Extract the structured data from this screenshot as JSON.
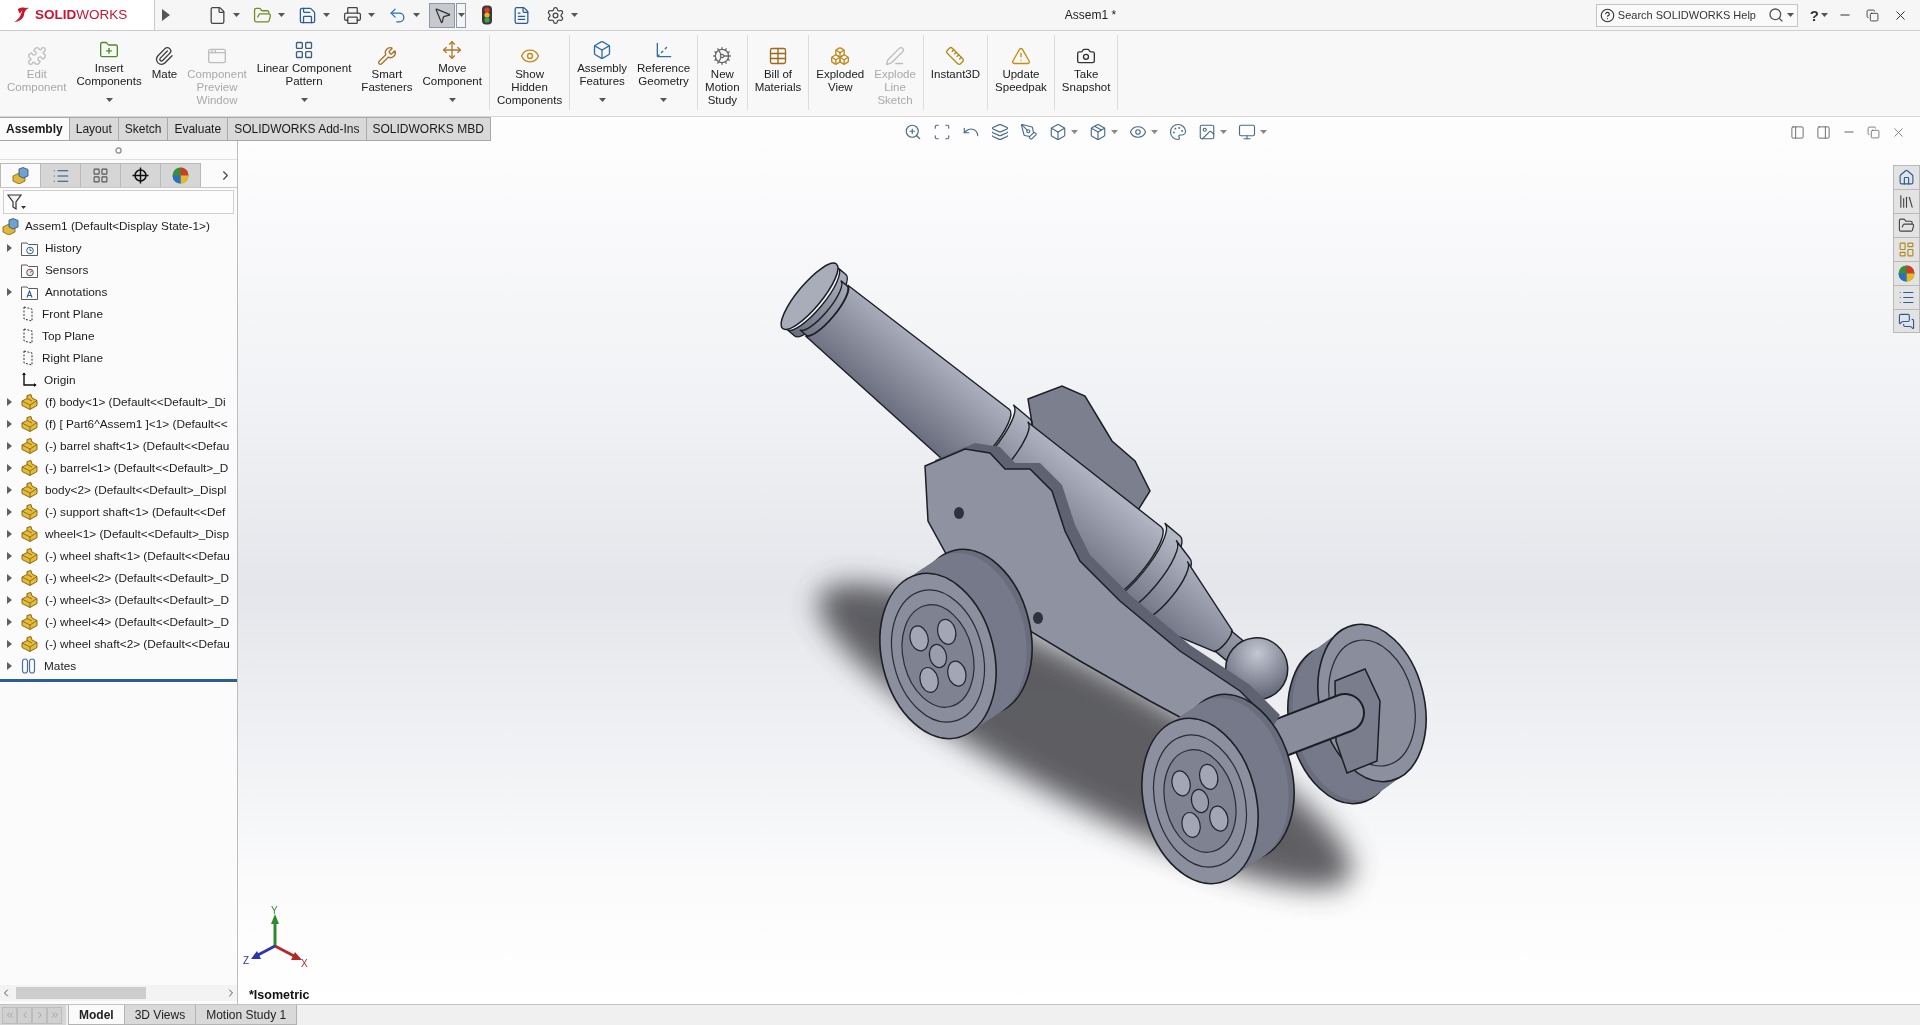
{
  "window": {
    "title": "Assem1 *"
  },
  "logo": {
    "text": "**SOLID**WORKS"
  },
  "quick_access": [
    {
      "selected": false,
      "dropdown": true
    },
    {
      "selected": false,
      "dropdown": true
    },
    {
      "selected": false,
      "dropdown": true
    },
    {
      "selected": false,
      "dropdown": true
    },
    {
      "selected": false,
      "dropdown": true
    },
    {
      "selected": true,
      "dropdown": true
    },
    {
      "selected": false,
      "dropdown": false
    },
    {
      "selected": false,
      "dropdown": false
    },
    {
      "selected": false,
      "dropdown": true
    }
  ],
  "help_search": {
    "placeholder": "Search SOLIDWORKS Help"
  },
  "help_menu": {
    "label": "?"
  },
  "command_manager": {
    "groups": [
      {
        "buttons": [
          {
            "lines": [
              "Edit",
              "Component"
            ],
            "disabled": true,
            "dropdown": false
          },
          {
            "lines": [
              "Insert",
              "Components"
            ],
            "disabled": false,
            "dropdown": true
          },
          {
            "lines": [
              "Mate"
            ],
            "disabled": false,
            "dropdown": false
          },
          {
            "lines": [
              "Component",
              "Preview",
              "Window"
            ],
            "disabled": true,
            "dropdown": false
          },
          {
            "lines": [
              "Linear Component",
              "Pattern"
            ],
            "disabled": false,
            "dropdown": true
          },
          {
            "lines": [
              "Smart",
              "Fasteners"
            ],
            "disabled": false,
            "dropdown": false
          },
          {
            "lines": [
              "Move",
              "Component"
            ],
            "disabled": false,
            "dropdown": true
          }
        ]
      },
      {
        "buttons": [
          {
            "lines": [
              "Show",
              "Hidden",
              "Components"
            ],
            "disabled": false,
            "dropdown": false
          }
        ]
      },
      {
        "buttons": [
          {
            "lines": [
              "Assembly",
              "Features"
            ],
            "disabled": false,
            "dropdown": true
          },
          {
            "lines": [
              "Reference",
              "Geometry"
            ],
            "disabled": false,
            "dropdown": true
          }
        ]
      },
      {
        "buttons": [
          {
            "lines": [
              "New",
              "Motion",
              "Study"
            ],
            "disabled": false,
            "dropdown": false
          }
        ]
      },
      {
        "buttons": [
          {
            "lines": [
              "Bill of",
              "Materials"
            ],
            "disabled": false,
            "dropdown": false
          }
        ]
      },
      {
        "buttons": [
          {
            "lines": [
              "Exploded",
              "View"
            ],
            "disabled": false,
            "dropdown": false
          },
          {
            "lines": [
              "Explode",
              "Line",
              "Sketch"
            ],
            "disabled": true,
            "dropdown": false
          }
        ]
      },
      {
        "buttons": [
          {
            "lines": [
              "Instant3D"
            ],
            "disabled": false,
            "dropdown": false
          }
        ]
      },
      {
        "buttons": [
          {
            "lines": [
              "Update",
              "Speedpak"
            ],
            "disabled": false,
            "dropdown": false
          }
        ]
      },
      {
        "buttons": [
          {
            "lines": [
              "Take",
              "Snapshot"
            ],
            "disabled": false,
            "dropdown": false
          }
        ]
      }
    ]
  },
  "command_tabs": [
    {
      "label": "Assembly",
      "selected": true
    },
    {
      "label": "Layout",
      "selected": false
    },
    {
      "label": "Sketch",
      "selected": false
    },
    {
      "label": "Evaluate",
      "selected": false
    },
    {
      "label": "SOLIDWORKS Add-Ins",
      "selected": false
    },
    {
      "label": "SOLIDWORKS MBD",
      "selected": false
    }
  ],
  "panel_tabs": [
    {
      "selected": true
    },
    {
      "selected": false
    },
    {
      "selected": false
    },
    {
      "selected": false
    },
    {
      "selected": false
    }
  ],
  "feature_tree": {
    "root": {
      "label": "Assem1 (Default<Display State-1>)",
      "kind": "assembly",
      "children": [
        {
          "label": "History",
          "kind": "history",
          "expander": true
        },
        {
          "label": "Sensors",
          "kind": "sensors",
          "expander": false
        },
        {
          "label": "Annotations",
          "kind": "annotations",
          "expander": true
        },
        {
          "label": "Front Plane",
          "kind": "plane",
          "expander": false
        },
        {
          "label": "Top Plane",
          "kind": "plane",
          "expander": false
        },
        {
          "label": "Right Plane",
          "kind": "plane",
          "expander": false
        },
        {
          "label": "Origin",
          "kind": "origin",
          "expander": false
        },
        {
          "label": "(f) body<1> (Default<<Default>_Di",
          "kind": "part",
          "expander": true
        },
        {
          "label": "(f) [ Part6^Assem1 ]<1> (Default<<",
          "kind": "part",
          "expander": true
        },
        {
          "label": "(-) barrel shaft<1> (Default<<Defau",
          "kind": "part",
          "expander": true
        },
        {
          "label": "(-) barrel<1> (Default<<Default>_D",
          "kind": "part",
          "expander": true
        },
        {
          "label": "body<2> (Default<<Default>_Displ",
          "kind": "part",
          "expander": true
        },
        {
          "label": "(-) support shaft<1> (Default<<Def",
          "kind": "part",
          "expander": true
        },
        {
          "label": "wheel<1> (Default<<Default>_Disp",
          "kind": "part",
          "expander": true
        },
        {
          "label": "(-) wheel shaft<1> (Default<<Defau",
          "kind": "part",
          "expander": true
        },
        {
          "label": "(-) wheel<2> (Default<<Default>_D",
          "kind": "part",
          "expander": true
        },
        {
          "label": "(-) wheel<3> (Default<<Default>_D",
          "kind": "part",
          "expander": true
        },
        {
          "label": "(-) wheel<4> (Default<<Default>_D",
          "kind": "part",
          "expander": true
        },
        {
          "label": "(-) wheel shaft<2> (Default<<Defau",
          "kind": "part",
          "expander": true
        },
        {
          "label": "Mates",
          "kind": "mates",
          "expander": true
        }
      ]
    }
  },
  "viewport": {
    "view_label": "*Isometric",
    "triad": {
      "x": "X",
      "y": "Y",
      "z": "Z"
    }
  },
  "bottom_tabs": [
    {
      "label": "Model",
      "selected": true
    },
    {
      "label": "3D Views",
      "selected": false
    },
    {
      "label": "Motion Study 1",
      "selected": false
    }
  ]
}
